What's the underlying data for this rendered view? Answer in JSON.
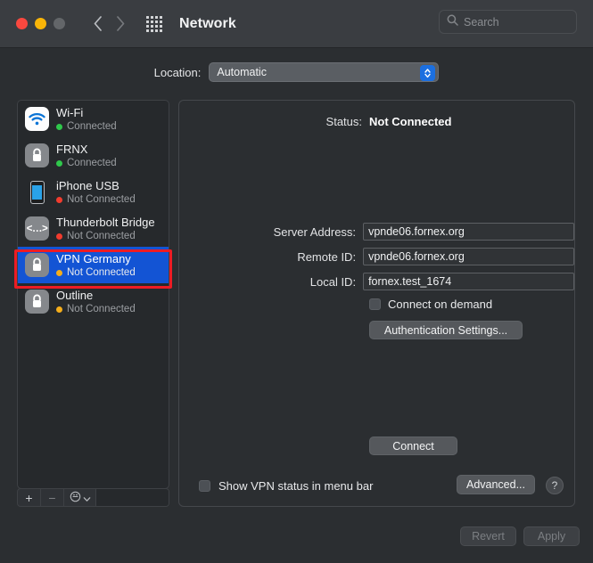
{
  "titlebar": {
    "window_title": "Network",
    "back_icon": "chevron-left-icon",
    "forward_icon": "chevron-right-icon",
    "grid_icon": "apps-grid-icon",
    "traffic_lights": [
      "close",
      "minimize",
      "zoom"
    ]
  },
  "search": {
    "placeholder": "Search",
    "icon": "search-icon",
    "value": ""
  },
  "location": {
    "label": "Location:",
    "selected": "Automatic",
    "options": [
      "Automatic"
    ]
  },
  "sidebar": {
    "services": [
      {
        "name": "Wi-Fi",
        "status": "Connected",
        "status_color": "#2fc84b",
        "icon": "wifi-icon",
        "selected": false
      },
      {
        "name": "FRNX",
        "status": "Connected",
        "status_color": "#2fc84b",
        "icon": "lock-icon",
        "selected": false
      },
      {
        "name": "iPhone USB",
        "status": "Not Connected",
        "status_color": "#f23c2e",
        "icon": "iphone-icon",
        "selected": false
      },
      {
        "name": "Thunderbolt Bridge",
        "status": "Not Connected",
        "status_color": "#f23c2e",
        "icon": "thunderbolt-bridge-icon",
        "selected": false
      },
      {
        "name": "VPN Germany",
        "status": "Not Connected",
        "status_color": "#f5ae1b",
        "icon": "lock-icon",
        "selected": true
      },
      {
        "name": "Outline",
        "status": "Not Connected",
        "status_color": "#f5ae1b",
        "icon": "lock-icon",
        "selected": false
      }
    ],
    "toolbar": {
      "add_label": "+",
      "remove_label": "−",
      "actions_icon": "gear-icon",
      "actions_chevron": "chevron-down-icon"
    },
    "highlight_color": "#ed1c24"
  },
  "main": {
    "status_label": "Status:",
    "status_value": "Not Connected",
    "server_address_label": "Server Address:",
    "server_address_value": "vpnde06.fornex.org",
    "remote_id_label": "Remote ID:",
    "remote_id_value": "vpnde06.fornex.org",
    "local_id_label": "Local ID:",
    "local_id_value": "fornex.test_1674",
    "connect_on_demand_label": "Connect on demand",
    "connect_on_demand_checked": false,
    "auth_settings_label": "Authentication Settings...",
    "connect_label": "Connect",
    "show_vpn_status_label": "Show VPN status in menu bar",
    "show_vpn_status_checked": false,
    "advanced_label": "Advanced...",
    "help_label": "?"
  },
  "footer": {
    "revert_label": "Revert",
    "apply_label": "Apply"
  }
}
